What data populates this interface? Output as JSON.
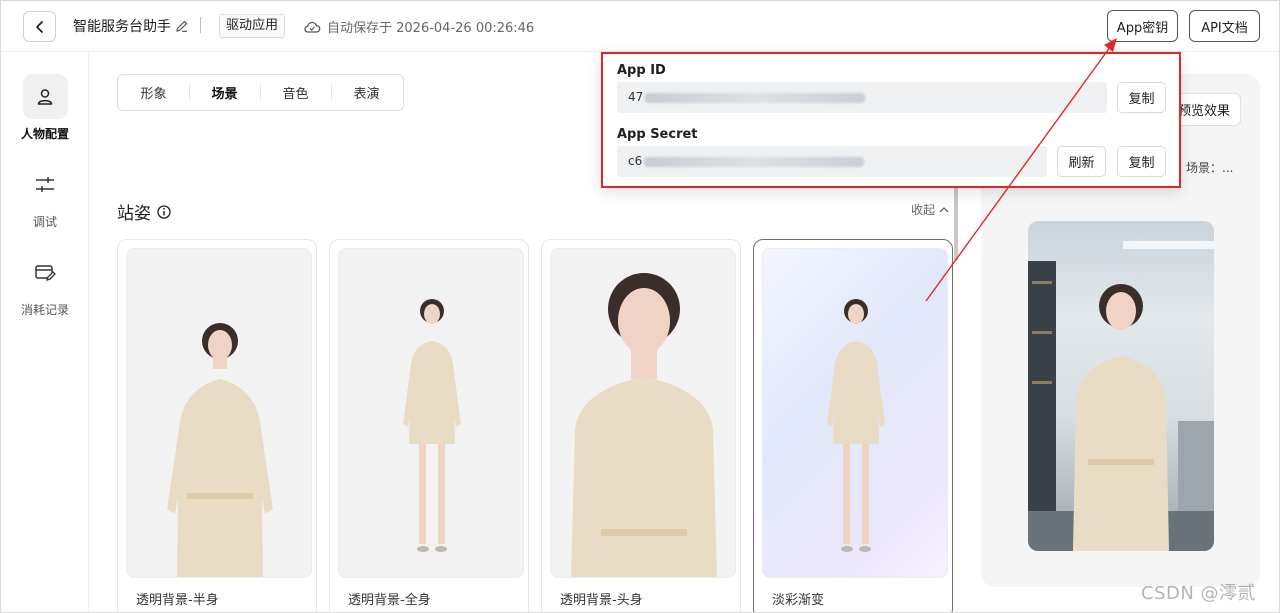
{
  "header": {
    "title": "智能服务台助手",
    "drive_tag": "驱动应用",
    "autosave": "自动保存于 2026-04-26 00:26:46",
    "app_key_button": "App密钥",
    "api_doc_button": "API文档"
  },
  "sidebar": {
    "items": [
      {
        "label": "人物配置",
        "icon": "person-icon",
        "active": true
      },
      {
        "label": "调试",
        "icon": "sliders-icon",
        "active": false
      },
      {
        "label": "消耗记录",
        "icon": "card-edit-icon",
        "active": false
      }
    ]
  },
  "tabs": [
    {
      "label": "形象",
      "active": false
    },
    {
      "label": "场景",
      "active": true
    },
    {
      "label": "音色",
      "active": false
    },
    {
      "label": "表演",
      "active": false
    }
  ],
  "section": {
    "title": "站姿",
    "collapse_label": "收起"
  },
  "cards": [
    {
      "label": "透明背景-半身",
      "selected": false
    },
    {
      "label": "透明背景-全身",
      "selected": false
    },
    {
      "label": "透明背景-头身",
      "selected": false
    },
    {
      "label": "淡彩渐变",
      "selected": true
    }
  ],
  "preview": {
    "button_label": "预览效果",
    "scene_label": "场景：..."
  },
  "popover": {
    "app_id_label": "App ID",
    "app_id_value_visible": "47",
    "app_secret_label": "App Secret",
    "app_secret_value_visible": "c6",
    "copy_label": "复制",
    "refresh_label": "刷新"
  },
  "watermark": "CSDN @澪贰",
  "colors": {
    "annotation_red": "#e0262b",
    "border_dark": "#555555",
    "panel_bg": "#f5f5f5"
  }
}
